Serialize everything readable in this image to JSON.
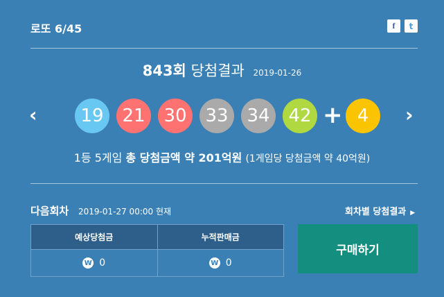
{
  "header": {
    "title": "로또 6/45",
    "social": {
      "facebook": "f",
      "twitter": "t"
    }
  },
  "round": {
    "number": "843회",
    "label": "당첨결과",
    "date": "2019-01-26"
  },
  "draw": {
    "numbers": [
      {
        "value": "19",
        "color": "#69c8f2"
      },
      {
        "value": "21",
        "color": "#ff7272"
      },
      {
        "value": "30",
        "color": "#ff7272"
      },
      {
        "value": "33",
        "color": "#aaaaaa"
      },
      {
        "value": "34",
        "color": "#aaaaaa"
      },
      {
        "value": "42",
        "color": "#b0d840"
      }
    ],
    "plus": "+",
    "bonus": {
      "value": "4",
      "color": "#fbc400"
    },
    "prev_arrow": "‹",
    "next_arrow": "›"
  },
  "summary": {
    "part1": "1등 5게임",
    "part2": "총 당첨금액 약 201억원",
    "part3": "(1게임당 당첨금액 약 40억원)"
  },
  "next_round": {
    "label": "다음회차",
    "datetime": "2019-01-27 00:00 현재",
    "history_link": "회차별 당첨결과",
    "history_arrow": "▶"
  },
  "stats": {
    "headers": [
      "예상당첨금",
      "누적판매금"
    ],
    "currency_symbol": "W",
    "values": [
      "0",
      "0"
    ]
  },
  "buy_button": "구매하기",
  "colors": {
    "panel_bg": "#3b80b5",
    "table_header_bg": "#2d5f8a",
    "buy_button_bg": "#148f7f"
  }
}
